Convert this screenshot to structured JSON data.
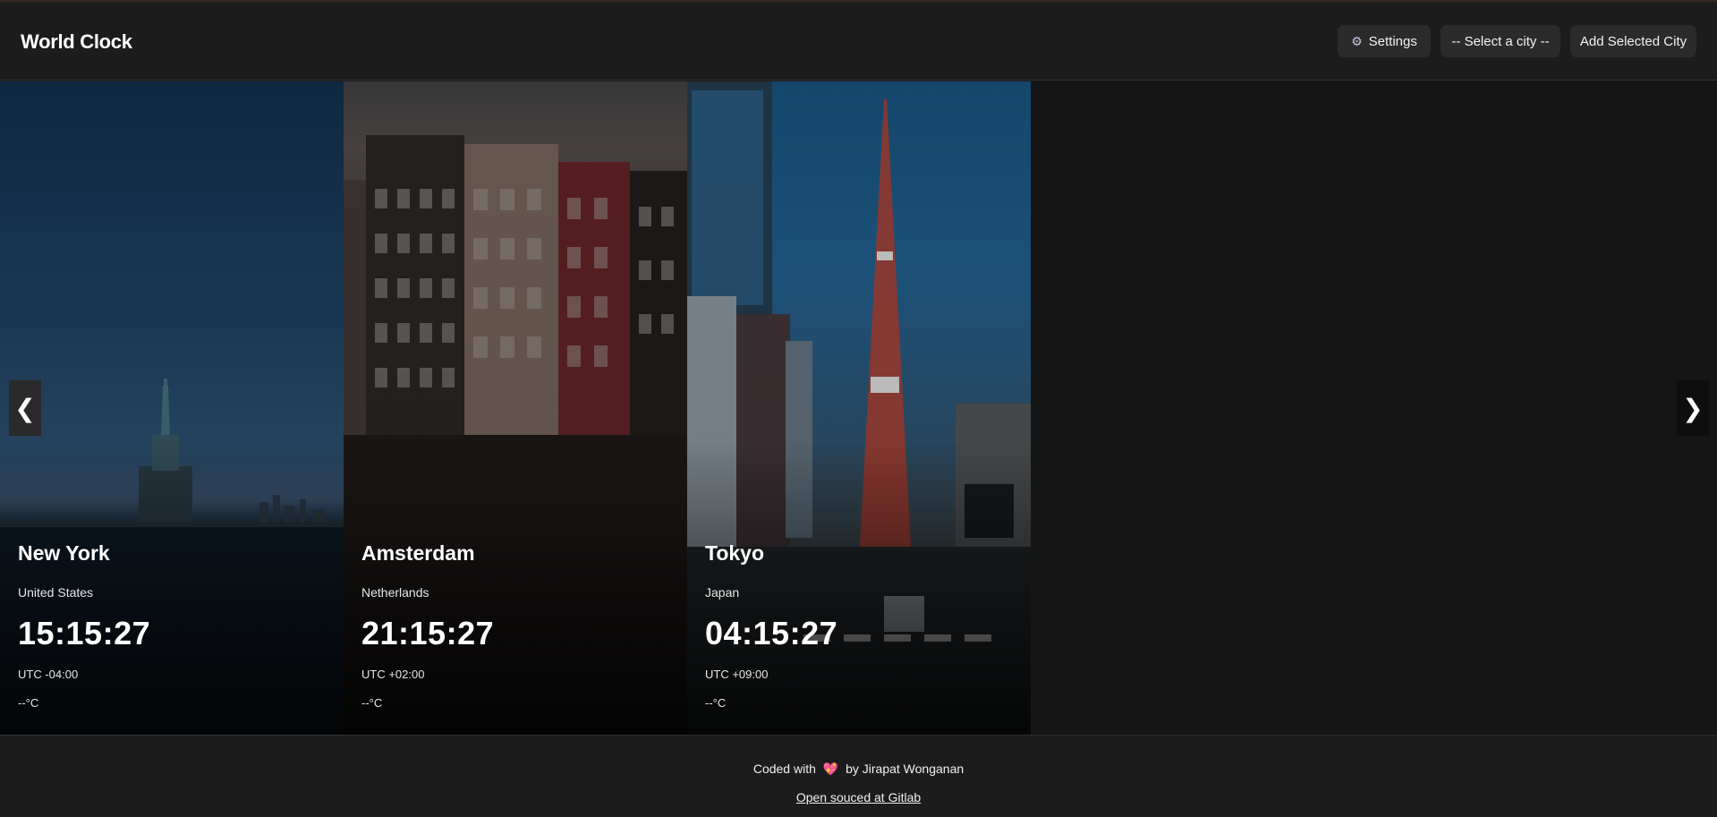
{
  "header": {
    "title": "World Clock",
    "settings_label": "Settings",
    "settings_icon": "gear-icon",
    "city_select_value": "-- Select a city --",
    "add_city_label": "Add Selected City"
  },
  "carousel": {
    "prev_icon": "chevron-left-icon",
    "next_icon": "chevron-right-icon",
    "cards": [
      {
        "city": "New York",
        "country": "United States",
        "time": "15:15:27",
        "utc": "UTC -04:00",
        "temp": "--°C"
      },
      {
        "city": "Amsterdam",
        "country": "Netherlands",
        "time": "21:15:27",
        "utc": "UTC +02:00",
        "temp": "--°C"
      },
      {
        "city": "Tokyo",
        "country": "Japan",
        "time": "04:15:27",
        "utc": "UTC +09:00",
        "temp": "--°C"
      }
    ]
  },
  "footer": {
    "credit_prefix": "Coded with",
    "credit_suffix": "by Jirapat Wonganan",
    "heart_icon": "heart-icon",
    "source_link": "Open souced at Gitlab"
  },
  "colors": {
    "background": "#1a1a1a",
    "header_bg": "#1c1c1c",
    "button_bg": "#2b2b2b",
    "heart": "#e8508a"
  }
}
